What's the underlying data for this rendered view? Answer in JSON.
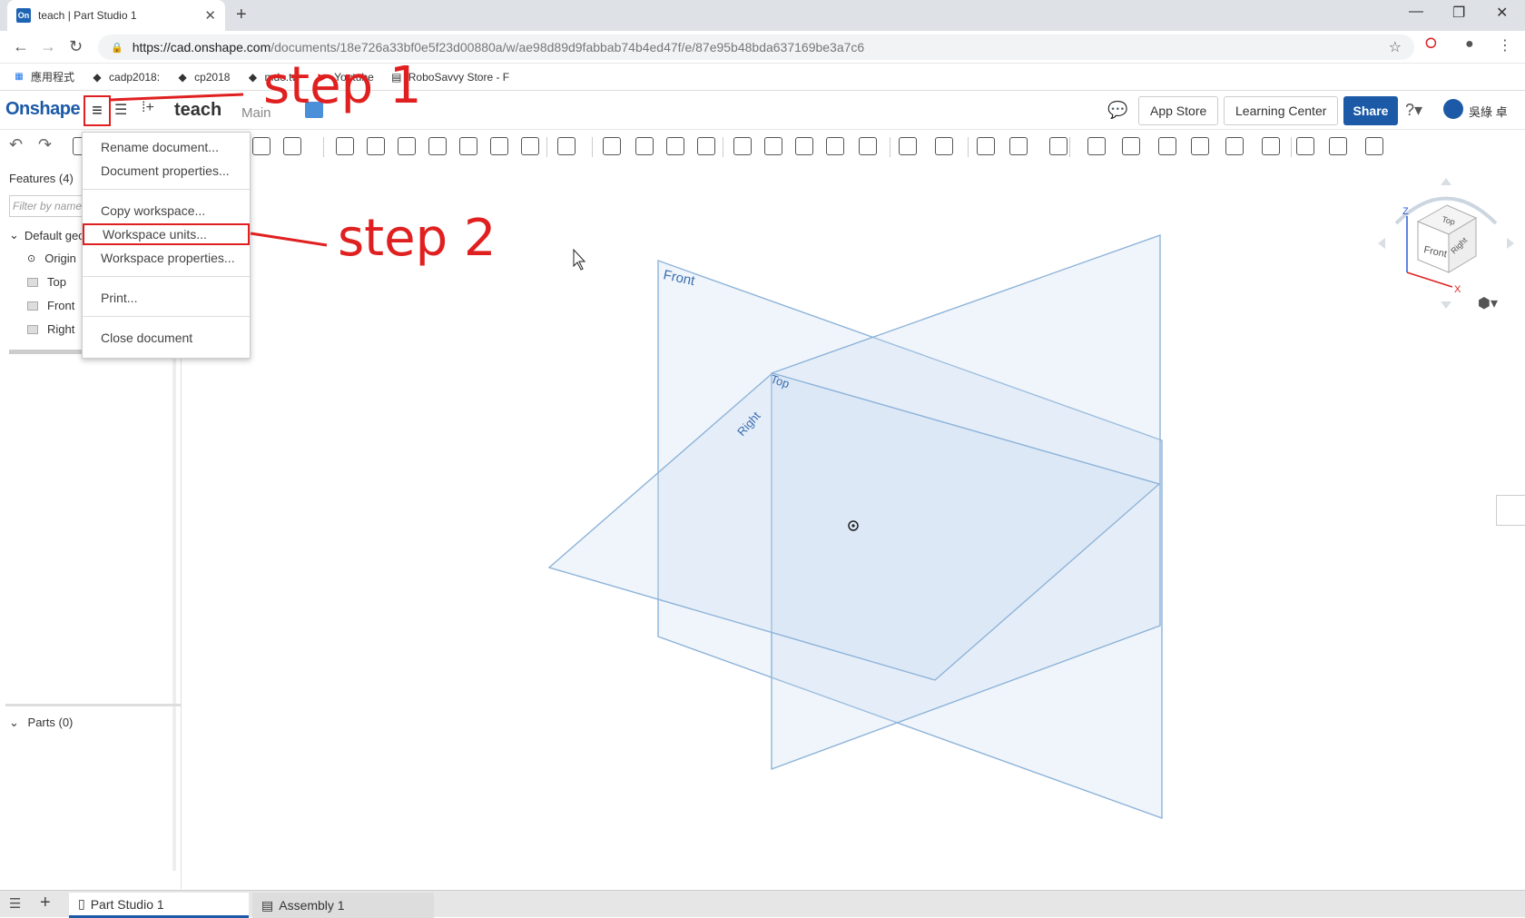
{
  "browser": {
    "tab_title": "teach | Part Studio 1",
    "tab_favicon": "On",
    "url_host": "https://cad.onshape.com",
    "url_path": "/documents/18e726a33bf0e5f23d00880a/w/ae98d89d9fabbab74b4ed47f/e/87e95b48bda637169be3a7c6"
  },
  "bookmarks": [
    {
      "label": "應用程式",
      "icon": "apps-icon"
    },
    {
      "label": "cadp2018:",
      "icon": "github-icon"
    },
    {
      "label": "cp2018",
      "icon": "github-icon"
    },
    {
      "label": "mde.tw",
      "icon": "github-icon"
    },
    {
      "label": "Youtube",
      "icon": "youtube-icon"
    },
    {
      "label": "RoboSavvy Store - F",
      "icon": "store-icon"
    }
  ],
  "header": {
    "logo": "Onshape",
    "doc_name": "teach",
    "branch": "Main",
    "app_store": "App Store",
    "learning_center": "Learning Center",
    "share": "Share",
    "user": "吳綠 卓"
  },
  "menu": {
    "items": [
      "Rename document...",
      "Document properties...",
      "Copy workspace...",
      "Workspace units...",
      "Workspace properties...",
      "Print...",
      "Close document"
    ]
  },
  "features": {
    "title": "Features (4)",
    "filter_placeholder": "Filter by name",
    "group": "Default geo",
    "items": [
      "Origin",
      "Top",
      "Front",
      "Right"
    ],
    "parts": "Parts (0)"
  },
  "viewport": {
    "plane_labels": [
      "Front",
      "Top",
      "Right"
    ],
    "cube_labels": [
      "Top",
      "Front",
      "Right"
    ],
    "axes": [
      "Z",
      "X"
    ]
  },
  "annotations": {
    "step1": "step 1",
    "step2": "step 2",
    "color": "#e02020"
  },
  "bottom_tabs": [
    "Part Studio 1",
    "Assembly 1"
  ]
}
